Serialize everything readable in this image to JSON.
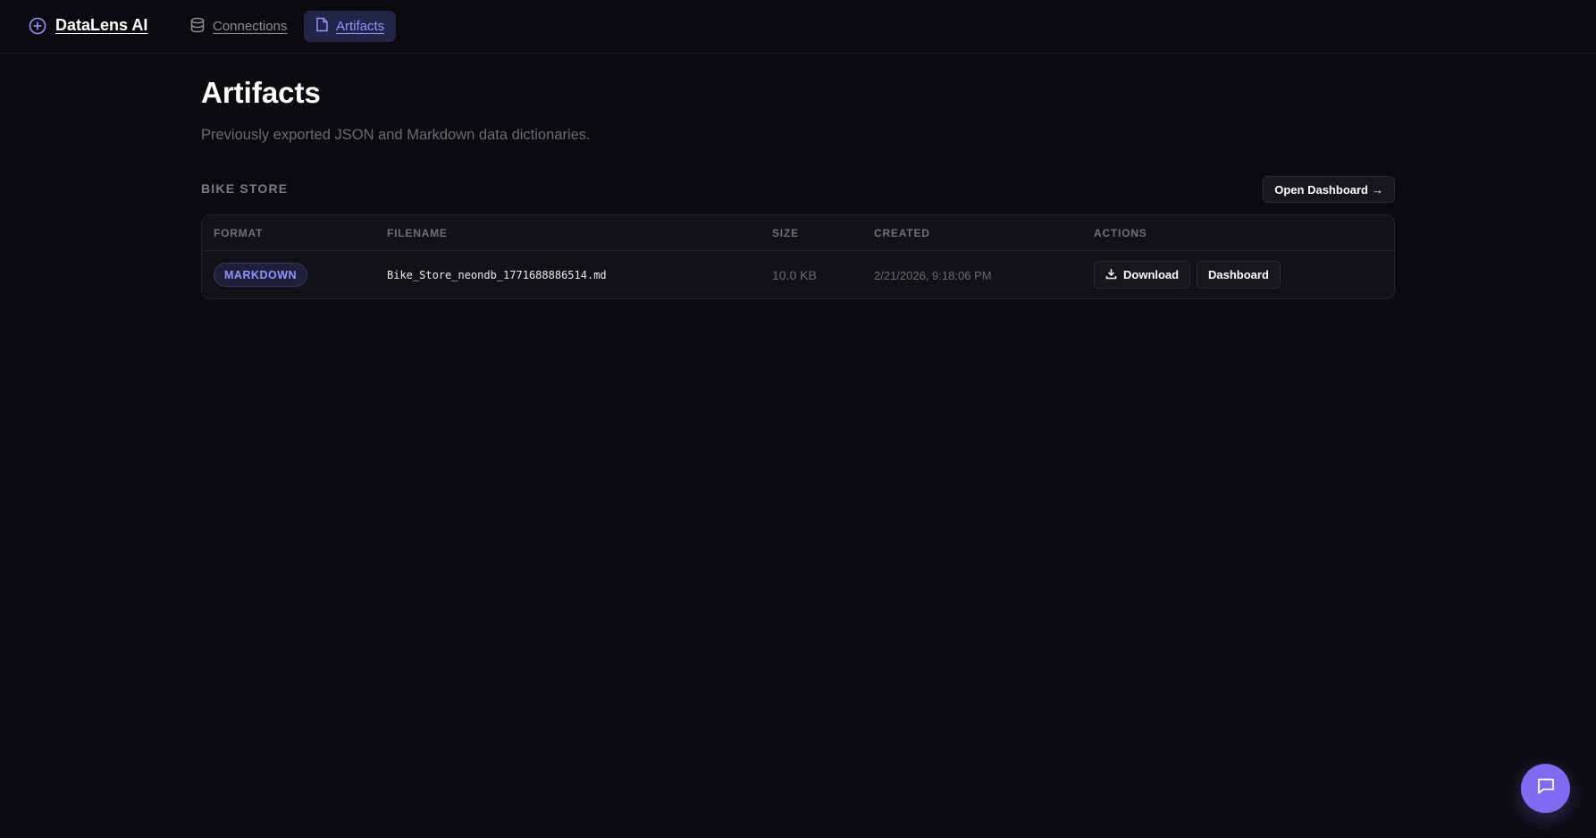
{
  "header": {
    "brand": "DataLens AI",
    "brand_icon": "plus-circle-icon",
    "nav": [
      {
        "label": "Connections",
        "icon": "database-icon",
        "active": false
      },
      {
        "label": "Artifacts",
        "icon": "file-icon",
        "active": true
      }
    ]
  },
  "page": {
    "title": "Artifacts",
    "subtitle": "Previously exported JSON and Markdown data dictionaries."
  },
  "group": {
    "title": "BIKE STORE",
    "open_dashboard_label": "Open Dashboard",
    "open_dashboard_arrow": "→"
  },
  "table": {
    "columns": [
      "FORMAT",
      "FILENAME",
      "SIZE",
      "CREATED",
      "ACTIONS"
    ],
    "rows": [
      {
        "format": "MARKDOWN",
        "filename": "Bike_Store_neondb_1771688886514.md",
        "size": "10.0 KB",
        "created": "2/21/2026, 9:18:06 PM",
        "download_label": "Download",
        "dashboard_label": "Dashboard"
      }
    ]
  },
  "colors": {
    "background": "#0b0b0f",
    "accent": "#8f95ff",
    "fab": "#7f6cf2"
  },
  "chat_fab_icon": "chat-icon"
}
